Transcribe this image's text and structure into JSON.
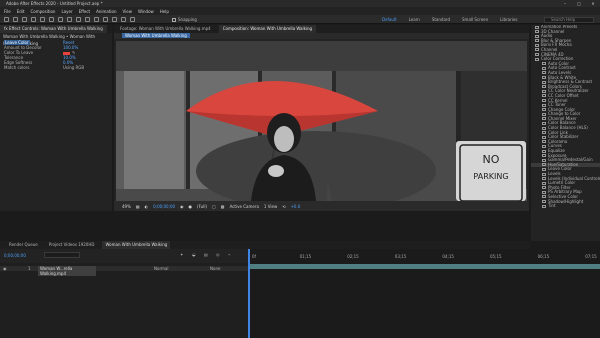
{
  "app": {
    "title": "Adobe After Effects 2020 - Untitled Project.aep *",
    "window_controls": [
      "–",
      "□",
      "✕"
    ]
  },
  "menu": [
    "File",
    "Edit",
    "Composition",
    "Layer",
    "Effect",
    "Animation",
    "View",
    "Window",
    "Help"
  ],
  "toolbar": {
    "snapping_label": "Snapping",
    "workspaces": [
      "Default",
      "Learn",
      "Standard",
      "Small Screen",
      "Libraries"
    ],
    "search_placeholder": "Search Help"
  },
  "effect_controls": {
    "tab": "fx Effect Controls: Woman With Umbrella Walking",
    "header": "Woman With Umbrella Walking • Woman With Umbrella Walking",
    "rows": [
      {
        "name": "Leave Color",
        "value": "Reset",
        "selected": true
      },
      {
        "name": "Amount to Decolor",
        "value": "100.0%"
      },
      {
        "name": "Color To Leave",
        "value": "",
        "swatch": true
      },
      {
        "name": "Tolerance",
        "value": "10.0%"
      },
      {
        "name": "Edge Softness",
        "value": "0.0%"
      },
      {
        "name": "Match colors",
        "value": "Using RGB"
      }
    ]
  },
  "composition": {
    "tabs": [
      "Footage: Woman With Umbrella Walking.mp4",
      "Composition: Woman With Umbrella Walking"
    ],
    "breadcrumb": "Woman With Umbrella Walking",
    "sign_line1": "NO",
    "sign_line2": "PARKING",
    "bar": {
      "zoom": "49%",
      "timecode": "0;00;00;00",
      "resolution": "(Full)",
      "camera": "Active Camera",
      "views": "1 View",
      "exposure": "+0.0"
    }
  },
  "effects_presets": {
    "items": [
      {
        "label": "Animation Presets",
        "child": false
      },
      {
        "label": "3D Channel",
        "child": false
      },
      {
        "label": "Audio",
        "child": false
      },
      {
        "label": "Blur & Sharpen",
        "child": false
      },
      {
        "label": "Boris FX Mocha",
        "child": false
      },
      {
        "label": "Channel",
        "child": false
      },
      {
        "label": "CINEMA 4D",
        "child": false
      },
      {
        "label": "Color Correction",
        "child": false
      },
      {
        "label": "Auto Color",
        "child": true
      },
      {
        "label": "Auto Contrast",
        "child": true
      },
      {
        "label": "Auto Levels",
        "child": true
      },
      {
        "label": "Black & White",
        "child": true
      },
      {
        "label": "Brightness & Contrast",
        "child": true
      },
      {
        "label": "Broadcast Colors",
        "child": true
      },
      {
        "label": "CC Color Neutralizer",
        "child": true
      },
      {
        "label": "CC Color Offset",
        "child": true
      },
      {
        "label": "CC Kernel",
        "child": true
      },
      {
        "label": "CC Toner",
        "child": true
      },
      {
        "label": "Change Color",
        "child": true
      },
      {
        "label": "Change to Color",
        "child": true
      },
      {
        "label": "Channel Mixer",
        "child": true
      },
      {
        "label": "Color Balance",
        "child": true
      },
      {
        "label": "Color Balance (HLS)",
        "child": true
      },
      {
        "label": "Color Link",
        "child": true
      },
      {
        "label": "Color Stabilizer",
        "child": true
      },
      {
        "label": "Colorama",
        "child": true
      },
      {
        "label": "Curves",
        "child": true
      },
      {
        "label": "Equalize",
        "child": true
      },
      {
        "label": "Exposure",
        "child": true
      },
      {
        "label": "Gamma/Pedestal/Gain",
        "child": true
      },
      {
        "label": "Hue/Saturation",
        "child": true,
        "selected": true
      },
      {
        "label": "Leave Color",
        "child": true
      },
      {
        "label": "Levels",
        "child": true
      },
      {
        "label": "Levels (Individual Controls)",
        "child": true
      },
      {
        "label": "Lumetri Color",
        "child": true
      },
      {
        "label": "Photo Filter",
        "child": true
      },
      {
        "label": "PS Arbitrary Map",
        "child": true
      },
      {
        "label": "Selective Color",
        "child": true
      },
      {
        "label": "Shadow/Highlight",
        "child": true
      },
      {
        "label": "Tint",
        "child": true
      }
    ]
  },
  "timeline": {
    "tabs": [
      "Render Queue",
      "Project Videos 1920HD",
      "Woman With Umbrella Walking"
    ],
    "timecode": "0;00;00;00",
    "layer": {
      "index": "1",
      "name": "Woman W...rella Walking.mp4",
      "mode": "Normal",
      "parent": "None"
    },
    "ruler_ticks": [
      "0f",
      "01;15",
      "02;15",
      "03;15",
      "04;15",
      "05;15",
      "06;15",
      "07;15"
    ]
  }
}
